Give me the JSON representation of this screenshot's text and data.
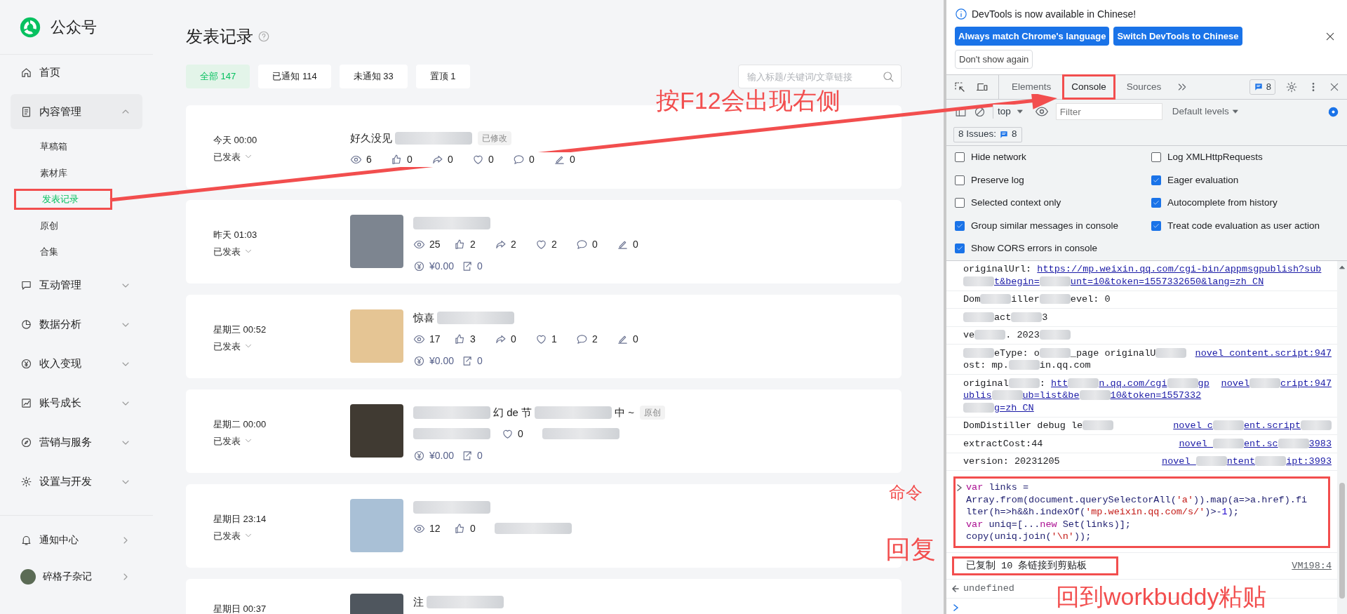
{
  "sidebar": {
    "logo_text": "公众号",
    "items": [
      {
        "label": "首页",
        "kind": "link"
      },
      {
        "label": "内容管理",
        "kind": "group",
        "expanded": true,
        "children": [
          {
            "label": "草稿箱",
            "selected": false
          },
          {
            "label": "素材库",
            "selected": false
          },
          {
            "label": "发表记录",
            "selected": true
          },
          {
            "label": "原创",
            "selected": false
          },
          {
            "label": "合集",
            "selected": false
          }
        ]
      },
      {
        "label": "互动管理",
        "kind": "group",
        "expanded": false
      },
      {
        "label": "数据分析",
        "kind": "group",
        "expanded": false
      },
      {
        "label": "收入变现",
        "kind": "group",
        "expanded": false
      },
      {
        "label": "账号成长",
        "kind": "group",
        "expanded": false
      },
      {
        "label": "营销与服务",
        "kind": "group",
        "expanded": false
      },
      {
        "label": "设置与开发",
        "kind": "group",
        "expanded": false
      }
    ],
    "footer": [
      {
        "label": "通知中心",
        "kind": "notifications"
      },
      {
        "label": "碎格子杂记",
        "kind": "account"
      }
    ]
  },
  "main": {
    "title": "发表记录",
    "tabs": [
      {
        "label": "全部 147",
        "selected": true
      },
      {
        "label": "已通知 114",
        "selected": false
      },
      {
        "label": "未通知 33",
        "selected": false
      },
      {
        "label": "置顶 1",
        "selected": false
      }
    ],
    "search": {
      "placeholder": "输入标题/关键词/文章链接"
    },
    "posts": [
      {
        "time": "今天 00:00",
        "status": "已发表",
        "thumbnail": false,
        "title": [
          {
            "kind": "text",
            "text": "好久没见"
          },
          {
            "kind": "blur"
          }
        ],
        "badges": [
          "已修改"
        ],
        "stats": [
          {
            "kind": "views",
            "value": "6"
          },
          {
            "kind": "likes",
            "value": "0"
          },
          {
            "kind": "shares",
            "value": "0"
          },
          {
            "kind": "hearts",
            "value": "0"
          },
          {
            "kind": "comments",
            "value": "0"
          },
          {
            "kind": "notes",
            "value": "0"
          }
        ]
      },
      {
        "time": "昨天 01:03",
        "status": "已发表",
        "thumbnail": true,
        "title": [
          {
            "kind": "blur"
          }
        ],
        "stats": [
          {
            "kind": "views",
            "value": "25"
          },
          {
            "kind": "likes",
            "value": "2"
          },
          {
            "kind": "shares",
            "value": "2"
          },
          {
            "kind": "hearts",
            "value": "2"
          },
          {
            "kind": "comments",
            "value": "0"
          },
          {
            "kind": "notes",
            "value": "0"
          }
        ],
        "extra_stats": [
          {
            "kind": "income",
            "value": "¥0.00"
          },
          {
            "kind": "reposts",
            "value": "0"
          }
        ]
      },
      {
        "time": "星期三 00:52",
        "status": "已发表",
        "thumbnail": true,
        "title": [
          {
            "kind": "text",
            "text": "惊喜"
          },
          {
            "kind": "blur"
          }
        ],
        "stats": [
          {
            "kind": "views",
            "value": "17"
          },
          {
            "kind": "likes",
            "value": "3"
          },
          {
            "kind": "shares",
            "value": "0"
          },
          {
            "kind": "hearts",
            "value": "1"
          },
          {
            "kind": "comments",
            "value": "2"
          },
          {
            "kind": "notes",
            "value": "0"
          }
        ],
        "extra_stats": [
          {
            "kind": "income",
            "value": "¥0.00"
          },
          {
            "kind": "reposts",
            "value": "0"
          }
        ]
      },
      {
        "time": "星期二 00:00",
        "status": "已发表",
        "thumbnail": true,
        "title": [
          {
            "kind": "blur"
          },
          {
            "kind": "text",
            "text": "幻 de 节"
          },
          {
            "kind": "blur"
          },
          {
            "kind": "text",
            "text": "中 ~"
          }
        ],
        "badges": [
          "原创"
        ],
        "stats": [
          {
            "kind": "blur"
          },
          {
            "kind": "hearts",
            "value": "0"
          },
          {
            "kind": "blur"
          }
        ],
        "extra_stats": [
          {
            "kind": "income",
            "value": "¥0.00"
          },
          {
            "kind": "reposts",
            "value": "0"
          }
        ]
      },
      {
        "time": "星期日 23:14",
        "status": "已发表",
        "thumbnail": true,
        "title": [
          {
            "kind": "blur"
          }
        ],
        "stats": [
          {
            "kind": "views",
            "value": "12"
          },
          {
            "kind": "likes",
            "value": "0"
          },
          {
            "kind": "blur"
          }
        ]
      },
      {
        "time": "星期日 00:37",
        "thumbnail": true,
        "title": [
          {
            "kind": "text",
            "text": "注"
          },
          {
            "kind": "blur"
          }
        ]
      }
    ]
  },
  "devtools": {
    "banner": {
      "message": "DevTools is now available in Chinese!",
      "buttons": [
        "Always match Chrome's language",
        "Switch DevTools to Chinese"
      ],
      "secondary_button": "Don't show again"
    },
    "tabs": [
      {
        "label": "Elements",
        "selected": false
      },
      {
        "label": "Console",
        "selected": true
      },
      {
        "label": "Sources",
        "selected": false
      }
    ],
    "issues_count": "8",
    "toolbar": {
      "context": "top",
      "filter_placeholder": "Filter",
      "levels": "Default levels"
    },
    "issues": {
      "label": "8 Issues:",
      "count": "8"
    },
    "settings": [
      {
        "label": "Hide network",
        "checked": false
      },
      {
        "label": "Log XMLHttpRequests",
        "checked": false
      },
      {
        "label": "Preserve log",
        "checked": false
      },
      {
        "label": "Eager evaluation",
        "checked": true
      },
      {
        "label": "Selected context only",
        "checked": false
      },
      {
        "label": "Autocomplete from history",
        "checked": true
      },
      {
        "label": "Group similar messages in console",
        "checked": true
      },
      {
        "label": "Treat code evaluation as user action",
        "checked": true
      },
      {
        "label": "Show CORS errors in console",
        "checked": true
      }
    ],
    "messages": [
      {
        "parts": [
          {
            "kind": "text",
            "text": "originalUrl: "
          },
          {
            "kind": "link",
            "text": "https://mp.weixin.qq.com/cgi-bin/appmsgpublish?sub"
          },
          {
            "kind": "blur"
          },
          {
            "kind": "link",
            "text": "t&begin="
          },
          {
            "kind": "blur"
          },
          {
            "kind": "link",
            "text": "unt=10&token=1557332650&lang=zh_CN"
          }
        ]
      },
      {
        "parts": [
          {
            "kind": "text",
            "text": "Dom"
          },
          {
            "kind": "blur"
          },
          {
            "kind": "text",
            "text": "iller"
          },
          {
            "kind": "blur"
          },
          {
            "kind": "text",
            "text": "evel: 0"
          }
        ]
      },
      {
        "parts": [
          {
            "kind": "blur"
          },
          {
            "kind": "text",
            "text": "act"
          },
          {
            "kind": "blur"
          },
          {
            "kind": "text",
            "text": "3"
          }
        ]
      },
      {
        "parts": [
          {
            "kind": "text",
            "text": "ve"
          },
          {
            "kind": "blur"
          },
          {
            "kind": "text",
            "text": ". 2023"
          },
          {
            "kind": "blur"
          }
        ]
      },
      {
        "parts": [
          {
            "kind": "blur"
          },
          {
            "kind": "text",
            "text": "eType: o"
          },
          {
            "kind": "blur"
          },
          {
            "kind": "text",
            "text": "_page originalU"
          },
          {
            "kind": "blur"
          },
          {
            "kind": "text",
            "text": "ost: mp."
          },
          {
            "kind": "blur"
          },
          {
            "kind": "text",
            "text": "in.qq.com"
          }
        ],
        "source": [
          {
            "kind": "link",
            "text": "novel_content.script:947"
          }
        ]
      },
      {
        "parts": [
          {
            "kind": "text",
            "text": "original"
          },
          {
            "kind": "blur"
          },
          {
            "kind": "text",
            "text": ": "
          },
          {
            "kind": "link",
            "text": "htt"
          },
          {
            "kind": "blur"
          },
          {
            "kind": "link",
            "text": "n.qq.com/cgi"
          },
          {
            "kind": "blur"
          },
          {
            "kind": "link",
            "text": "gpublis"
          },
          {
            "kind": "blur"
          },
          {
            "kind": "link",
            "text": "ub=list&be"
          },
          {
            "kind": "blur"
          },
          {
            "kind": "link",
            "text": "10&token=1557332"
          },
          {
            "kind": "blur"
          },
          {
            "kind": "link",
            "text": "g=zh_CN"
          }
        ],
        "source": [
          {
            "kind": "link",
            "text": "novel"
          },
          {
            "kind": "blur"
          },
          {
            "kind": "link",
            "text": "cript:947"
          }
        ]
      },
      {
        "parts": [
          {
            "kind": "text",
            "text": "DomDistiller debug le"
          },
          {
            "kind": "blur"
          }
        ],
        "source": [
          {
            "kind": "link",
            "text": "novel_c"
          },
          {
            "kind": "blur"
          },
          {
            "kind": "link",
            "text": "ent.script"
          },
          {
            "kind": "blur"
          }
        ]
      },
      {
        "parts": [
          {
            "kind": "text",
            "text": "extractCost:44"
          }
        ],
        "source": [
          {
            "kind": "link",
            "text": "novel_"
          },
          {
            "kind": "blur"
          },
          {
            "kind": "link",
            "text": "ent.sc"
          },
          {
            "kind": "blur"
          },
          {
            "kind": "link",
            "text": "3983"
          }
        ]
      },
      {
        "parts": [
          {
            "kind": "text",
            "text": "version: 20231205"
          }
        ],
        "source": [
          {
            "kind": "link",
            "text": "novel_"
          },
          {
            "kind": "blur"
          },
          {
            "kind": "link",
            "text": "ntent"
          },
          {
            "kind": "blur"
          },
          {
            "kind": "link",
            "text": "ipt:3993"
          }
        ]
      }
    ],
    "command": [
      [
        {
          "kind": "keyword",
          "text": "var"
        },
        {
          "kind": "plain",
          "text": " links = Array.from(document.querySelectorAll("
        },
        {
          "kind": "string",
          "text": "'a'"
        },
        {
          "kind": "plain",
          "text": ")).map(a=>a.href).filter(h=>h&&h.indexOf("
        },
        {
          "kind": "string",
          "text": "'mp.weixin.qq.com/s/'"
        },
        {
          "kind": "plain",
          "text": ")>-"
        },
        {
          "kind": "number",
          "text": "1"
        },
        {
          "kind": "plain",
          "text": ");"
        }
      ],
      [
        {
          "kind": "keyword",
          "text": "var"
        },
        {
          "kind": "plain",
          "text": " uniq=[..."
        },
        {
          "kind": "keyword",
          "text": "new"
        },
        {
          "kind": "plain",
          "text": " Set(links)];"
        }
      ],
      [
        {
          "kind": "plain",
          "text": "copy(uniq.join("
        },
        {
          "kind": "string",
          "text": "'\\n'"
        },
        {
          "kind": "plain",
          "text": "));"
        }
      ]
    ],
    "output": {
      "text": "已复制 10 条链接到剪贴板",
      "source": "VM198:4"
    },
    "result": "undefined"
  },
  "annotations": {
    "labels": [
      "按F12会出现右侧",
      "命令",
      "回复",
      "回到workbuddy粘贴"
    ]
  }
}
